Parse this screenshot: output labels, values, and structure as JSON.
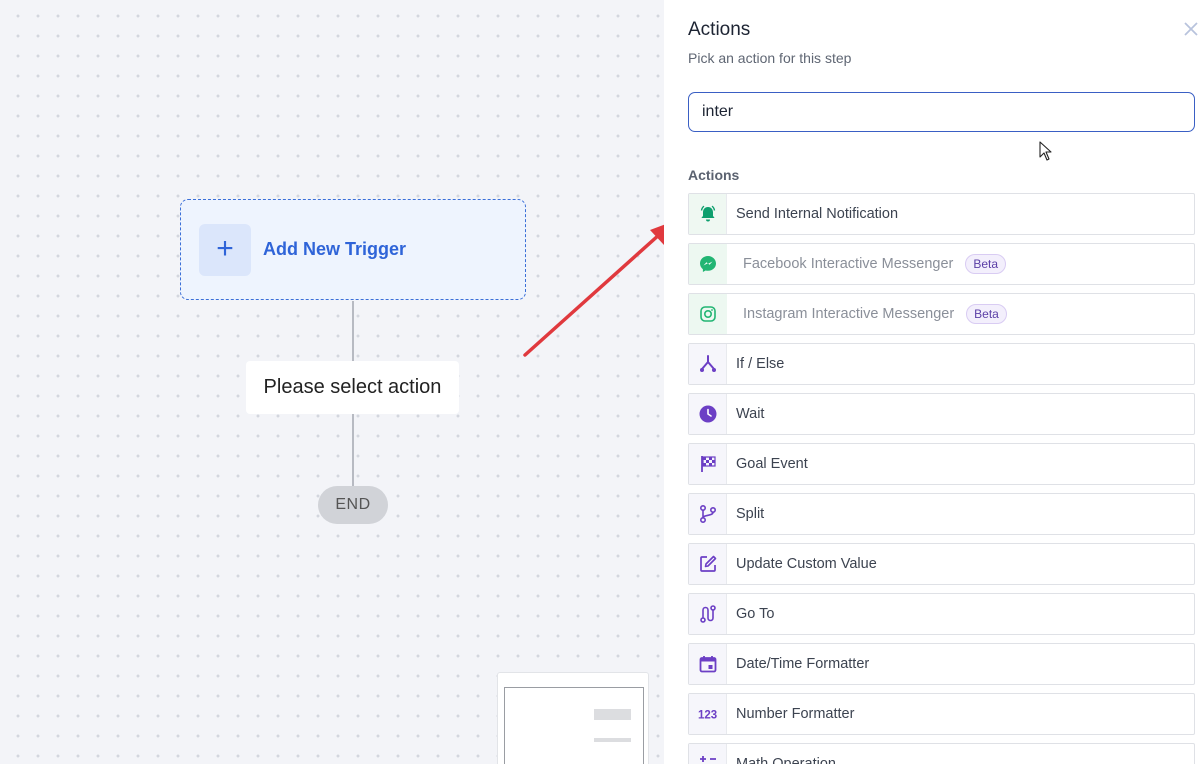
{
  "canvas": {
    "trigger_plus": "+",
    "trigger_label": "Add New Trigger",
    "placeholder_step": "Please select action",
    "end_label": "END"
  },
  "panel": {
    "title": "Actions",
    "subtitle": "Pick an action for this step",
    "search_value": "inter",
    "section_label": "Actions",
    "badge_text": "Beta",
    "actions": [
      {
        "label": "Send Internal Notification",
        "icon": "bell-icon",
        "color": "#0e9f6e"
      },
      {
        "label": "Facebook Interactive Messenger",
        "icon": "messenger-icon",
        "color": "#22b573",
        "beta": true
      },
      {
        "label": "Instagram Interactive Messenger",
        "icon": "instagram-icon",
        "color": "#22b573",
        "beta": true
      },
      {
        "label": "If / Else",
        "icon": "branch-icon",
        "color": "#6c3fc5"
      },
      {
        "label": "Wait",
        "icon": "clock-icon",
        "color": "#6c3fc5"
      },
      {
        "label": "Goal Event",
        "icon": "checkered-flag-icon",
        "color": "#6c3fc5"
      },
      {
        "label": "Split",
        "icon": "git-fork-icon",
        "color": "#6c3fc5"
      },
      {
        "label": "Update Custom Value",
        "icon": "edit-icon",
        "color": "#6c3fc5"
      },
      {
        "label": "Go To",
        "icon": "route-icon",
        "color": "#6c3fc5"
      },
      {
        "label": "Date/Time Formatter",
        "icon": "calendar-icon",
        "color": "#6c3fc5"
      },
      {
        "label": "Number Formatter",
        "icon": "numbers-icon",
        "color": "#6c3fc5"
      },
      {
        "label": "Math Operation",
        "icon": "math-icon",
        "color": "#6c3fc5"
      }
    ]
  },
  "colors": {
    "accent_blue": "#2f64d8",
    "accent_purple": "#6c3fc5",
    "accent_green": "#22b573",
    "arrow_red": "#e0393e"
  }
}
